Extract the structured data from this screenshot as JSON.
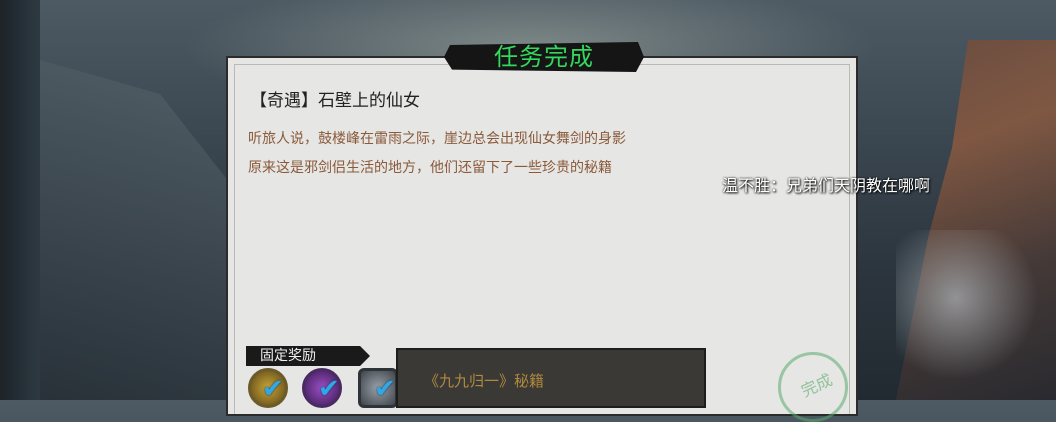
{
  "banner": {
    "title": "任务完成"
  },
  "quest": {
    "title": "【奇遇】石壁上的仙女",
    "description": [
      "听旅人说，鼓楼峰在雷雨之际，崖边总会出现仙女舞剑的身影",
      "原来这是邪剑侣生活的地方，他们还留下了一些珍贵的秘籍"
    ]
  },
  "chat": {
    "message": "温不胜：兄弟们天阴教在哪啊"
  },
  "rewards": {
    "label": "固定奖励",
    "items": [
      {
        "icon": "gold-scroll-icon",
        "claimed": true
      },
      {
        "icon": "purple-scroll-icon",
        "claimed": true
      },
      {
        "icon": "grey-item-icon",
        "claimed": true
      }
    ],
    "tooltip": "《九九归一》秘籍"
  },
  "stamp": {
    "text": "完成"
  },
  "colors": {
    "banner_text": "#33d85c",
    "description": "#8a5a3a",
    "tooltip_text": "#b08a3e",
    "check": "#2fa8e8"
  }
}
